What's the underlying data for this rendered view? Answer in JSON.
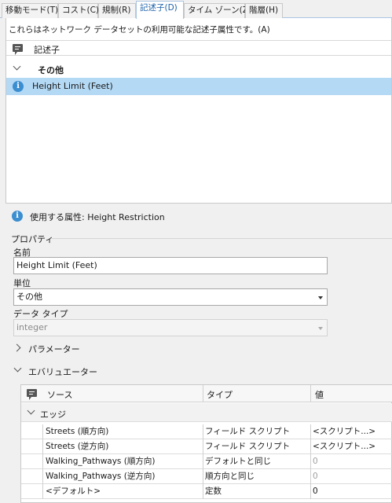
{
  "tabs": [
    {
      "label": "移動モード(T)",
      "active": false
    },
    {
      "label": "コスト(C)",
      "active": false
    },
    {
      "label": "規制(R)",
      "active": false
    },
    {
      "label": "記述子(D)",
      "active": true
    },
    {
      "label": "タイム ゾーン(Z)",
      "active": false
    },
    {
      "label": "階層(H)",
      "active": false
    }
  ],
  "description": "これらはネットワーク データセットの利用可能な記述子属性です。(A)",
  "descriptor_grid": {
    "header": "記述子",
    "group_label": "その他",
    "selected_item": "Height Limit (Feet)"
  },
  "used_attribute": "使用する属性: Height Restriction",
  "properties": {
    "section_title": "プロパティ",
    "name_label": "名前",
    "name_value": "Height Limit (Feet)",
    "unit_label": "単位",
    "unit_value": "その他",
    "datatype_label": "データ タイプ",
    "datatype_value": "integer"
  },
  "parameters_label": "パラメーター",
  "evaluators_label": "エバリュエーター",
  "evaluator_grid": {
    "columns": {
      "source": "ソース",
      "type": "タイプ",
      "value": "値"
    },
    "group_label": "エッジ",
    "rows": [
      {
        "source": "Streets (順方向)",
        "type": "フィールド スクリプト",
        "value": "<スクリプト...>",
        "value_disabled": false
      },
      {
        "source": "Streets (逆方向)",
        "type": "フィールド スクリプト",
        "value": "<スクリプト...>",
        "value_disabled": false
      },
      {
        "source": "Walking_Pathways (順方向)",
        "type": "デフォルトと同じ",
        "value": "0",
        "value_disabled": true
      },
      {
        "source": "Walking_Pathways (逆方向)",
        "type": "順方向と同じ",
        "value": "0",
        "value_disabled": true
      },
      {
        "source": "<デフォルト>",
        "type": "定数",
        "value": "0",
        "value_disabled": false
      }
    ]
  },
  "colors": {
    "selection": "#b4d9f5",
    "info": "#3b8ed0",
    "active_tab_text": "#1a5fa8"
  }
}
